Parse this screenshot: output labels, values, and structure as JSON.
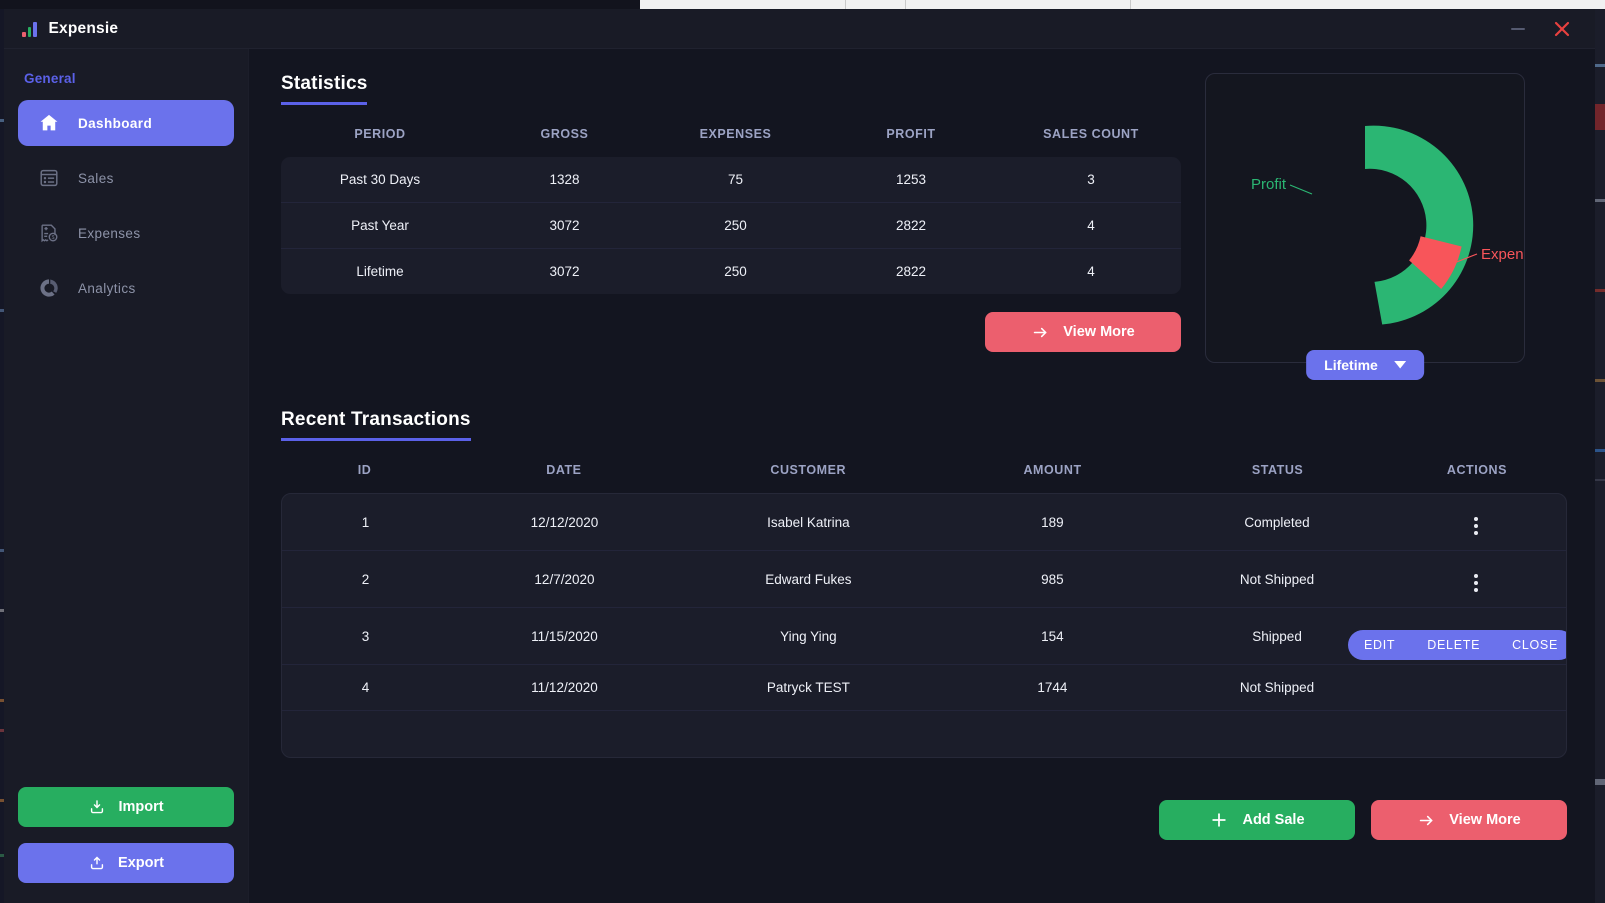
{
  "window": {
    "title": "Expensie",
    "logo_icon": "bar-chart-logo-icon",
    "minimize_label": "—",
    "close_label": "✕"
  },
  "colors": {
    "accent_purple": "#6b72ec",
    "accent_purple_text": "#5b61e8",
    "green": "#27ae60",
    "coral": "#ec5f6e",
    "profit_green": "#2bb673",
    "expenses_red": "#f8555a",
    "panel": "#1b1d2a",
    "background": "#131520",
    "sidebar": "#191b26",
    "header_text": "#9ca3c4"
  },
  "sidebar": {
    "group_label": "General",
    "items": [
      {
        "label": "Dashboard",
        "icon": "home-icon",
        "active": true
      },
      {
        "label": "Sales",
        "icon": "receipt-list-icon",
        "active": false
      },
      {
        "label": "Expenses",
        "icon": "invoice-dollar-icon",
        "active": false
      },
      {
        "label": "Analytics",
        "icon": "donut-chart-icon",
        "active": false
      }
    ],
    "import_button": "Import",
    "import_icon": "download-icon",
    "export_button": "Export",
    "export_icon": "upload-icon"
  },
  "statistics": {
    "title": "Statistics",
    "columns": [
      "PERIOD",
      "GROSS",
      "EXPENSES",
      "PROFIT",
      "SALES COUNT"
    ],
    "rows": [
      {
        "period": "Past 30 Days",
        "gross": "1328",
        "expenses": "75",
        "profit": "1253",
        "sales_count": "3"
      },
      {
        "period": "Past Year",
        "gross": "3072",
        "expenses": "250",
        "profit": "2822",
        "sales_count": "4"
      },
      {
        "period": "Lifetime",
        "gross": "3072",
        "expenses": "250",
        "profit": "2822",
        "sales_count": "4"
      }
    ],
    "view_more_button": "View More",
    "view_more_icon": "arrow-right-icon"
  },
  "chart_data": {
    "type": "pie",
    "title": "",
    "labels": [
      "Profit",
      "Expenses"
    ],
    "values": [
      2822,
      250
    ],
    "colors": [
      "#2bb673",
      "#f8555a"
    ],
    "legend_position": "callout-labels",
    "donut": true,
    "period_selected": "Lifetime",
    "period_caret_icon": "chevron-down-icon"
  },
  "transactions": {
    "title": "Recent Transactions",
    "columns": [
      "ID",
      "DATE",
      "CUSTOMER",
      "AMOUNT",
      "STATUS",
      "ACTIONS"
    ],
    "rows": [
      {
        "id": "1",
        "date": "12/12/2020",
        "customer": "Isabel Katrina",
        "amount": "189",
        "status": "Completed",
        "actions": "menu"
      },
      {
        "id": "2",
        "date": "12/7/2020",
        "customer": "Edward Fukes",
        "amount": "985",
        "status": "Not Shipped",
        "actions": "menu"
      },
      {
        "id": "3",
        "date": "11/15/2020",
        "customer": "Ying Ying",
        "amount": "154",
        "status": "Shipped",
        "actions": "menu"
      },
      {
        "id": "4",
        "date": "11/12/2020",
        "customer": "Patryck TEST",
        "amount": "1744",
        "status": "Not Shipped",
        "actions": "expanded"
      }
    ],
    "row_actions": [
      "EDIT",
      "DELETE",
      "CLOSE"
    ],
    "add_sale_button": "Add Sale",
    "add_sale_icon": "plus-icon",
    "view_more_button": "View More",
    "view_more_icon": "arrow-right-icon"
  }
}
